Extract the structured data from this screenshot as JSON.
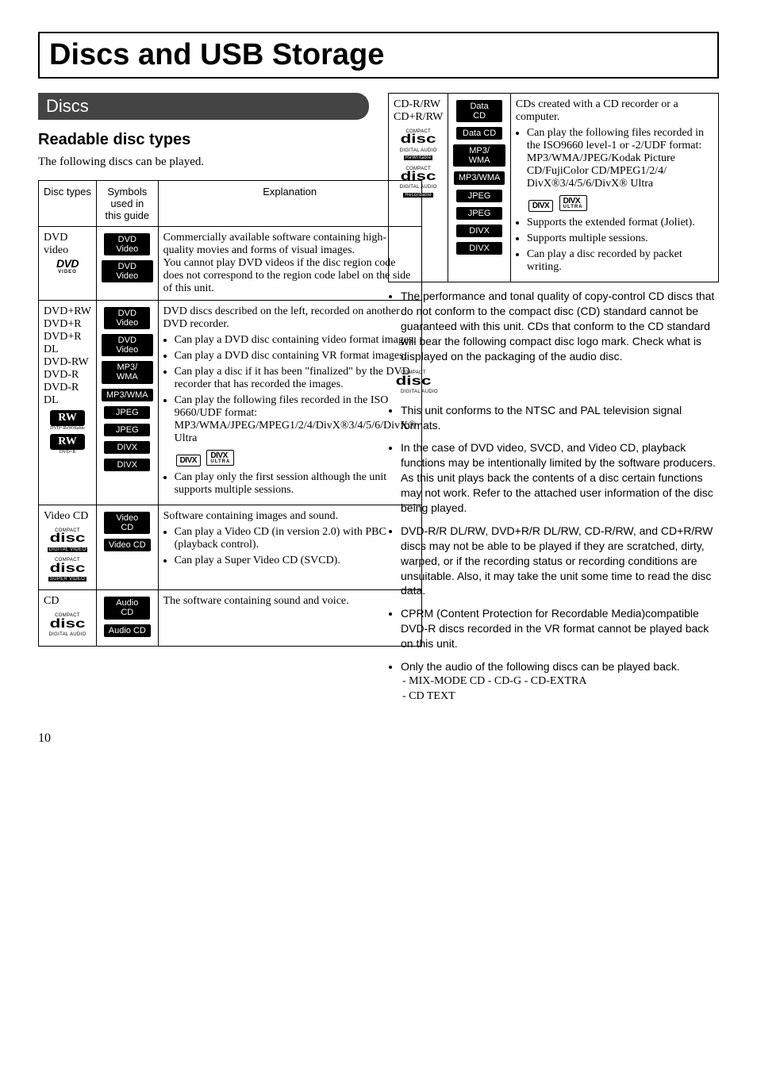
{
  "pageTitle": "Discs and USB Storage",
  "pageNumber": "10",
  "discs": {
    "heading": "Discs",
    "readable": {
      "heading": "Readable disc types",
      "lead": "The following discs can be played."
    }
  },
  "tableHeaders": {
    "col1": "Disc types",
    "col2": "Symbols used in this guide",
    "col3": "Explanation"
  },
  "rows": {
    "dvdvideo": {
      "type": "DVD video",
      "logoMain": "DVD",
      "logoSub": "VIDEO",
      "badge1": "DVD Video",
      "badge2": "DVD Video",
      "explanation": "Commercially available software containing high-quality movies and forms of visual images.\nYou cannot play DVD videos if the disc region code does not correspond to the region code label on the side of this unit."
    },
    "dvdrw": {
      "types": [
        "DVD+RW",
        "DVD+R",
        "DVD+R DL",
        "DVD-RW",
        "DVD-R",
        "DVD-R DL"
      ],
      "rwLabel": "RW",
      "rwSub1": "DVD+ReWritable",
      "rwSub2": "DVD+R",
      "badges": [
        "DVD Video",
        "DVD Video",
        "MP3/ WMA",
        "MP3/WMA",
        "JPEG",
        "JPEG"
      ],
      "divxBadge": "DIVX",
      "explIntro": "DVD discs described on the left, recorded on another DVD recorder.",
      "bullets": [
        "Can play a DVD disc containing video format images.",
        "Can play a DVD disc containing VR format images.",
        "Can play a disc if it has been \"finalized\" by the DVD recorder that has recorded the images.",
        "Can play the following files recorded in the ISO 9660/UDF format:\nMP3/WMA/JPEG/MPEG1/2/4/DivX®3/4/5/6/DivX® Ultra"
      ],
      "divxLabel": "DIVX",
      "divxUltra": "ULTRA",
      "lastBullet": "Can play only the first session although the unit supports multiple sessions."
    },
    "vcd": {
      "type": "Video CD",
      "badge1": "Video CD",
      "badge2": "Video CD",
      "explIntro": "Software containing images and sound.",
      "bullets": [
        "Can play a Video CD (in version 2.0) with PBC (playback control).",
        "Can play a Super Video CD (SVCD)."
      ]
    },
    "cd": {
      "type": "CD",
      "badge1": "Audio CD",
      "badge2": "Audio CD",
      "explanation": "The software containing sound and voice."
    },
    "cdr": {
      "types": [
        "CD-R/RW",
        "CD+R/RW"
      ],
      "badges": [
        "Data CD",
        "Data CD",
        "MP3/ WMA",
        "MP3/WMA",
        "JPEG",
        "JPEG"
      ],
      "divxBadge": "DIVX",
      "explIntro": "CDs created with a CD recorder or a computer.",
      "bullet1": "Can play the following files recorded in the ISO9660 level-1 or -2/UDF format:\nMP3/WMA/JPEG/Kodak Picture CD/FujiColor CD/MPEG1/2/4/\nDivX®3/4/5/6/DivX® Ultra",
      "divxLabel": "DIVX",
      "divxUltra": "ULTRA",
      "tailBullets": [
        "Supports the extended format (Joliet).",
        "Supports multiple sessions.",
        "Can play a disc recorded by packet writing."
      ]
    },
    "discLogo": {
      "compact": "COMPACT",
      "disc": "disc",
      "digitalAudio": "DIGITAL AUDIO",
      "digitalVideo": "DIGITAL VIDEO",
      "superVideo": "SUPER VIDEO",
      "rewritable": "ReWritable",
      "recordable": "Recordable"
    }
  },
  "notes": [
    "The performance and tonal quality of copy-control CD discs that do not conform to the compact disc (CD) standard cannot be guaranteed with this unit. CDs that conform to the CD standard will bear the following compact disc logo mark. Check what is displayed on the packaging of the audio disc.",
    "This unit conforms to the NTSC and PAL television signal formats.",
    "In the case of DVD video, SVCD, and Video CD, playback functions may be intentionally limited by the software producers. As this unit plays back the contents of a disc certain functions may not work. Refer to the attached user information of the disc being played.",
    "DVD-R/R DL/RW, DVD+R/R DL/RW, CD-R/RW, and CD+R/RW discs may not be able to be played if they are scratched, dirty, warped, or if the recording status or recording conditions are unsuitable. Also, it may take the unit some time to read the disc data.",
    "CPRM (Content Protection for Recordable Media)compatible DVD-R discs recorded in the VR format cannot be played back on this unit.",
    "Only the audio of the following discs can be played back."
  ],
  "audioOnly": {
    "line1": "- MIX-MODE CD   - CD-G   - CD-EXTRA",
    "line2": "- CD TEXT"
  }
}
